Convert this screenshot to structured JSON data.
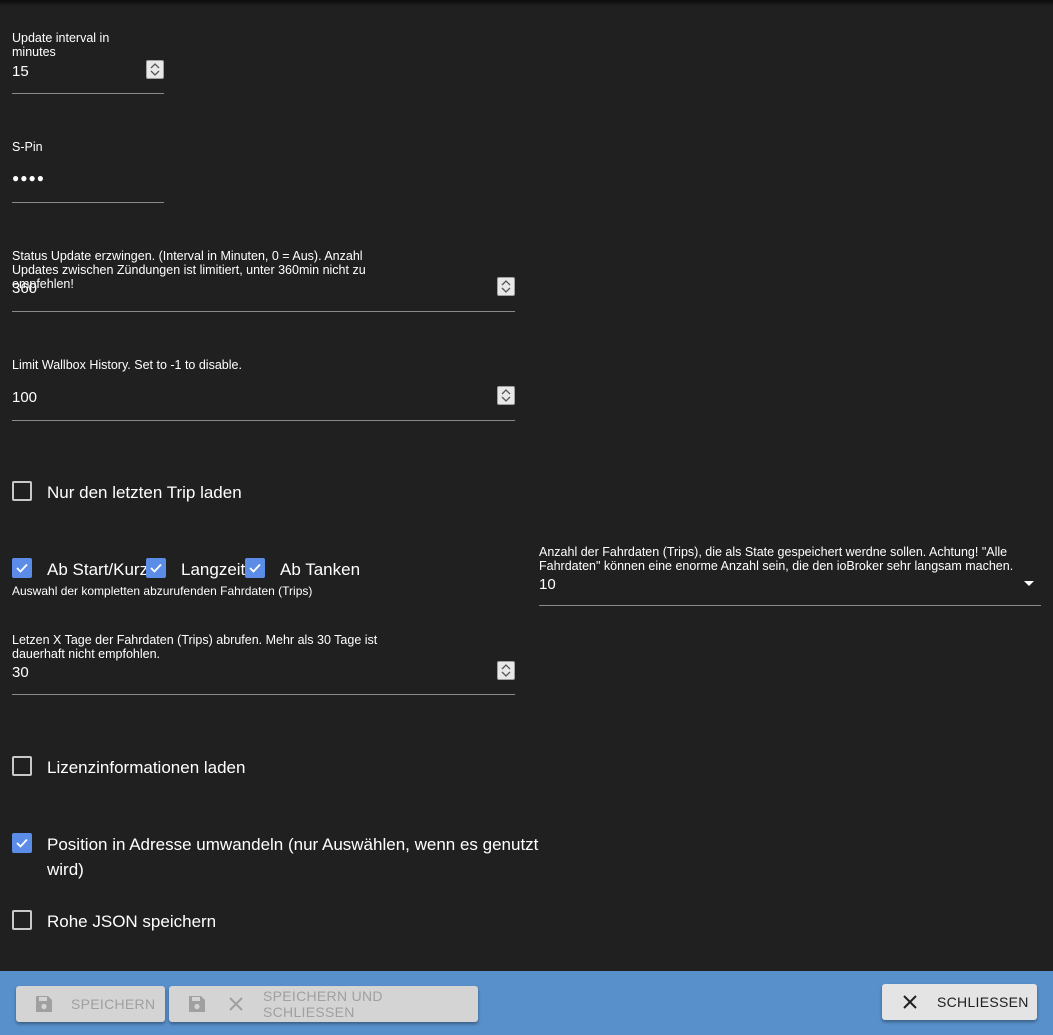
{
  "fields": {
    "update_interval": {
      "label": "Update interval in minutes",
      "value": "15"
    },
    "spin": {
      "label": "S-Pin",
      "value": "●●●●"
    },
    "force_status": {
      "label": "Status Update erzwingen. (Interval in Minuten, 0 = Aus). Anzahl Updates zwischen Zündungen ist limitiert, unter 360min nicht zu empfehlen!",
      "value": "360"
    },
    "wallbox_history": {
      "label": "Limit Wallbox History. Set to -1 to disable.",
      "value": "100"
    },
    "last_days": {
      "label": "Letzen X Tage der Fahrdaten (Trips) abrufen. Mehr als 30 Tage ist dauerhaft nicht empfohlen.",
      "value": "30"
    },
    "trip_count": {
      "label": "Anzahl der Fahrdaten (Trips), die als State gespeichert werdne sollen. Achtung! \"Alle Fahrdaten\" können eine enorme Anzahl sein, die den ioBroker sehr langsam machen.",
      "value": "10"
    }
  },
  "checkboxes": {
    "last_trip": {
      "label": "Nur den letzten Trip laden",
      "checked": false
    },
    "start_short": {
      "label": "Ab Start/Kurz",
      "checked": true
    },
    "long_term": {
      "label": "Langzeit",
      "checked": true
    },
    "refuel": {
      "label": "Ab Tanken",
      "checked": true
    },
    "license": {
      "label": "Lizenzinformationen laden",
      "checked": false
    },
    "position": {
      "label_line1": "Position in Adresse umwandeln (nur Auswählen, wenn es genutzt",
      "label_line2": "wird)",
      "checked": true
    },
    "raw_json": {
      "label": "Rohe JSON speichern",
      "checked": false
    }
  },
  "trip_selection_hint": "Auswahl der kompletten abzurufenden Fahrdaten (Trips)",
  "footer": {
    "save": "SPEICHERN",
    "save_close": "SPEICHERN UND SCHLIESSEN",
    "close": "SCHLIESSEN",
    "bar_color": "#5890cc",
    "checkbox_color": "#5b8de8"
  }
}
